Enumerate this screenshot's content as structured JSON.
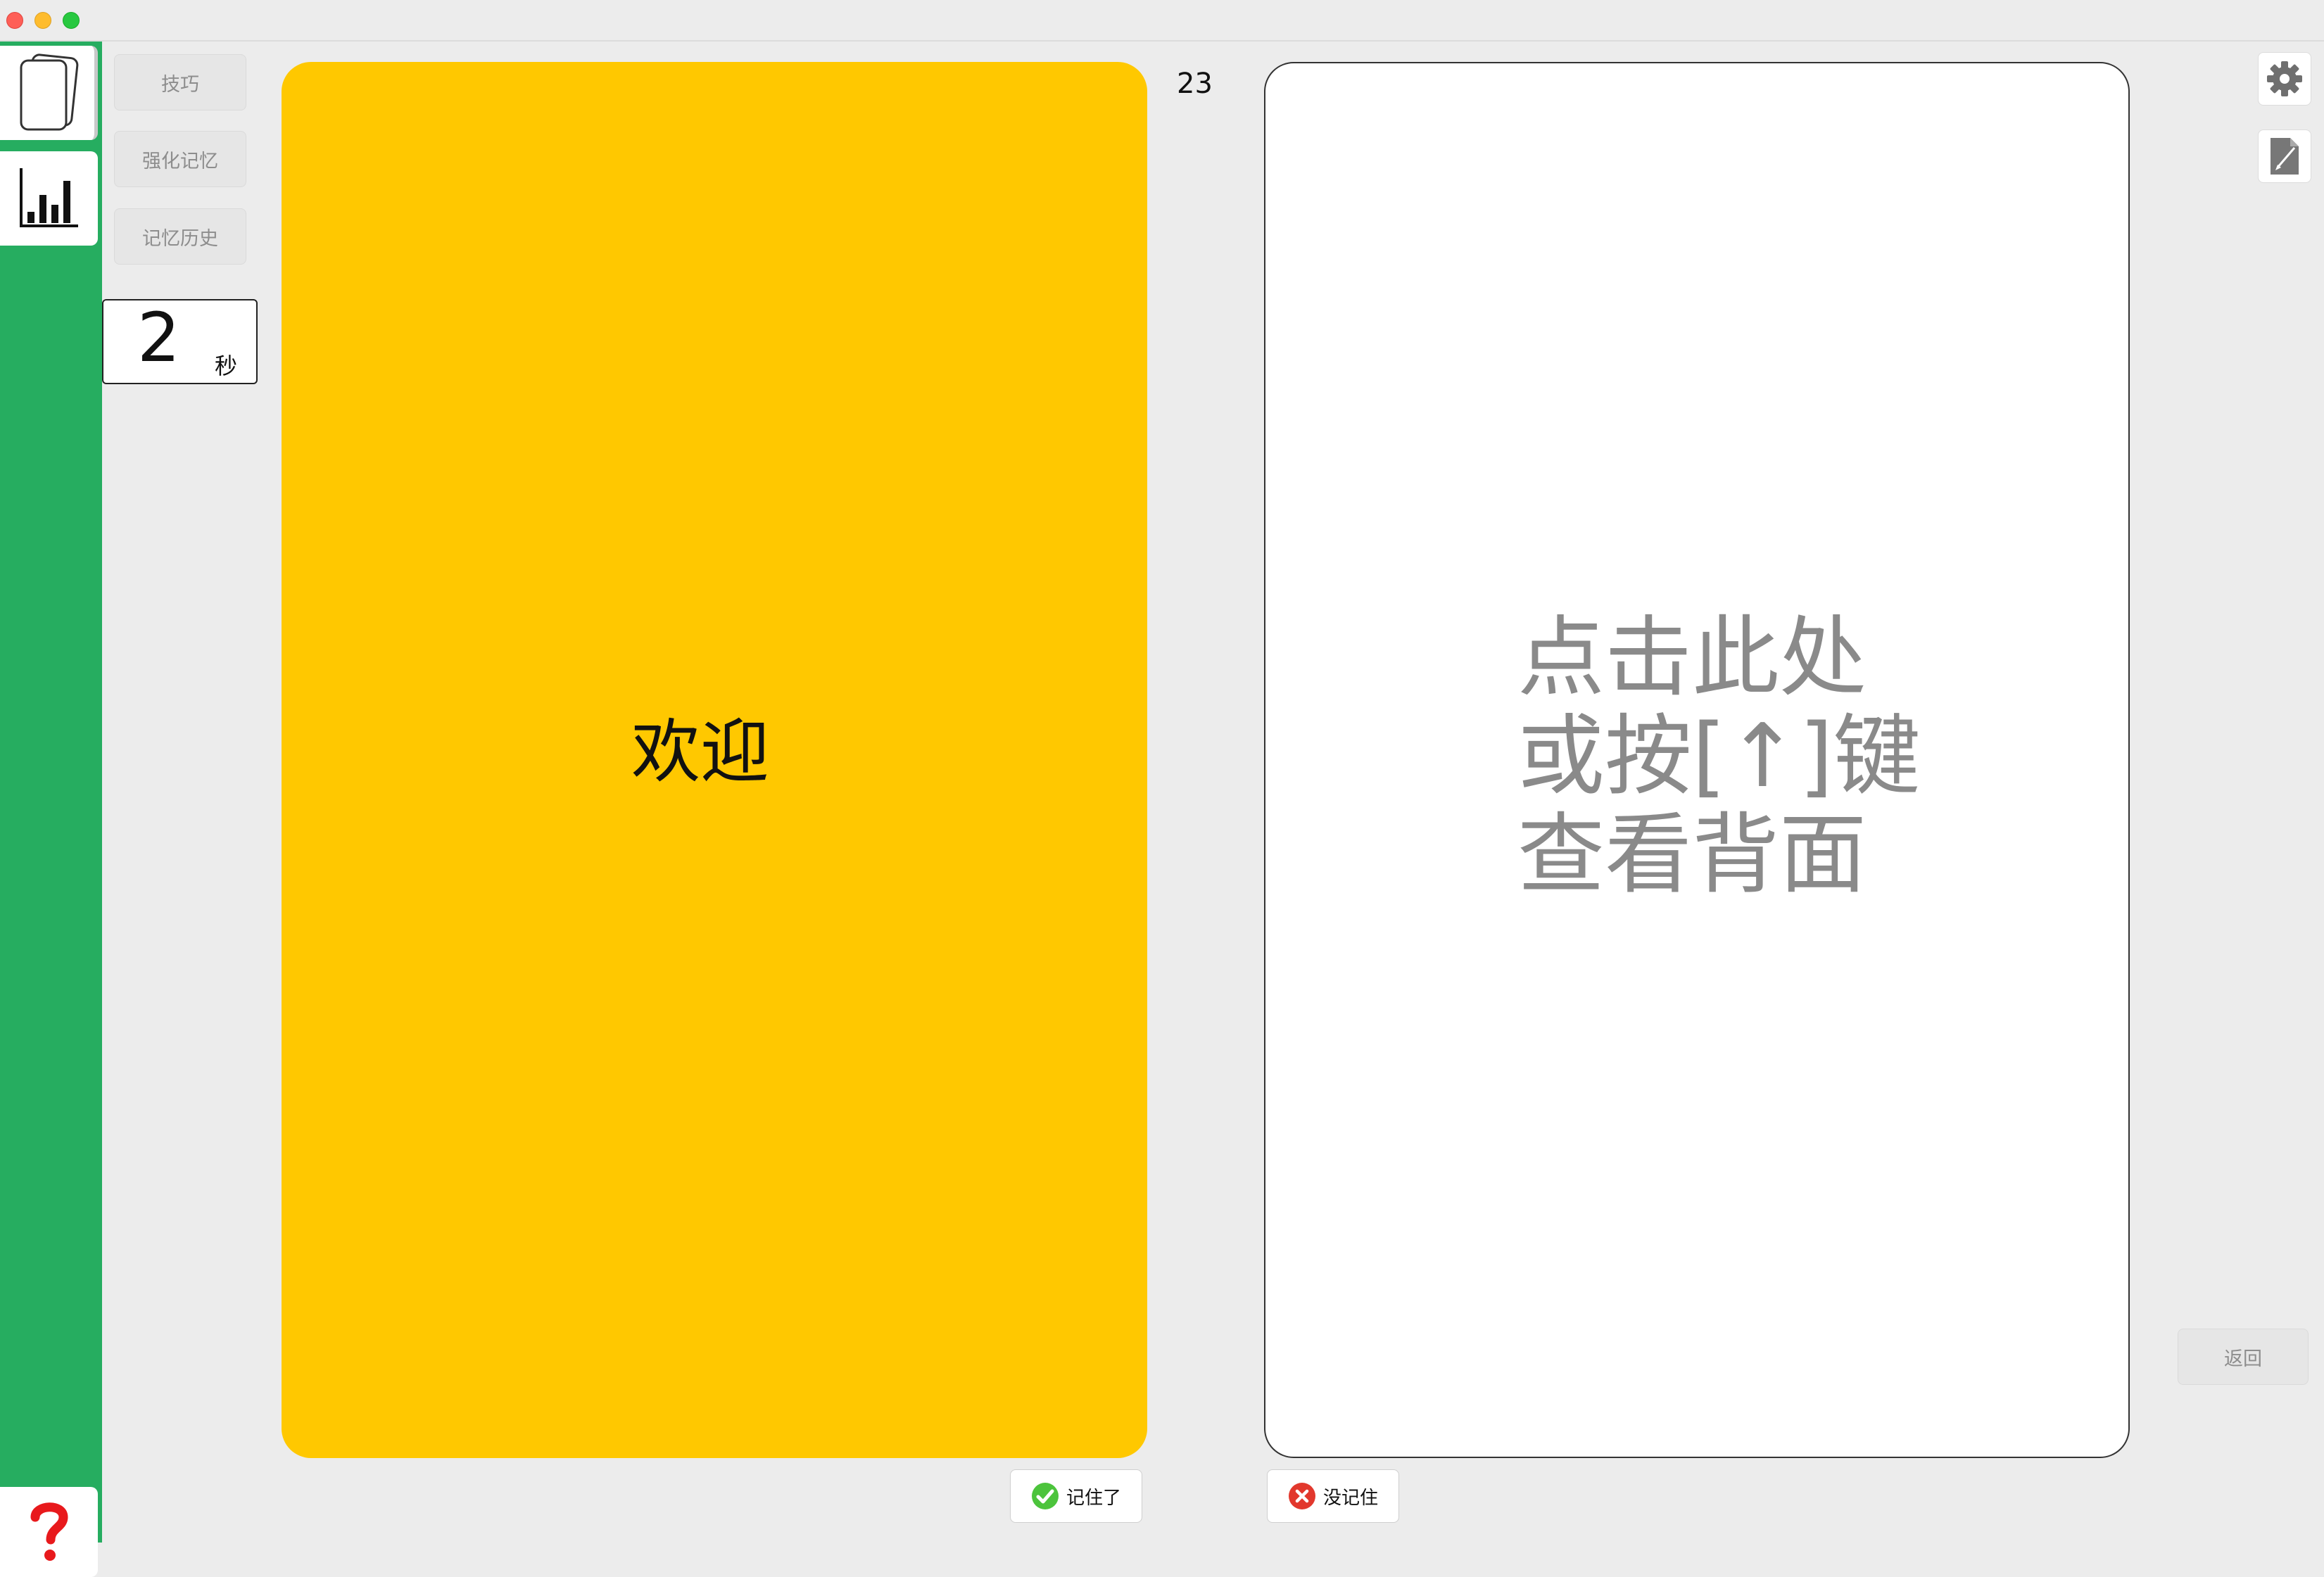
{
  "sidebar": {
    "cards_icon": "cards-icon",
    "stats_icon": "bar-chart-icon",
    "help_icon": "question-mark-icon"
  },
  "toolbar": {
    "tips_label": "技巧",
    "reinforce_label": "强化记忆",
    "history_label": "记忆历史"
  },
  "timer": {
    "value": "2",
    "unit": "秒"
  },
  "card": {
    "front_text": "欢迎",
    "back_hint": "点击此处\n或按[↑]键\n查看背面",
    "front_color": "#ffc800"
  },
  "counter": "23",
  "right_panel": {
    "settings_icon": "gear-icon",
    "edit_icon": "edit-document-icon",
    "back_label": "返回"
  },
  "actions": {
    "remembered_label": "记住了",
    "forgot_label": "没记住"
  },
  "colors": {
    "sidebar": "#26ad60",
    "accent_yellow": "#ffc800",
    "success_green": "#4cc43c",
    "error_red": "#e2382d",
    "help_red": "#e8191c"
  }
}
